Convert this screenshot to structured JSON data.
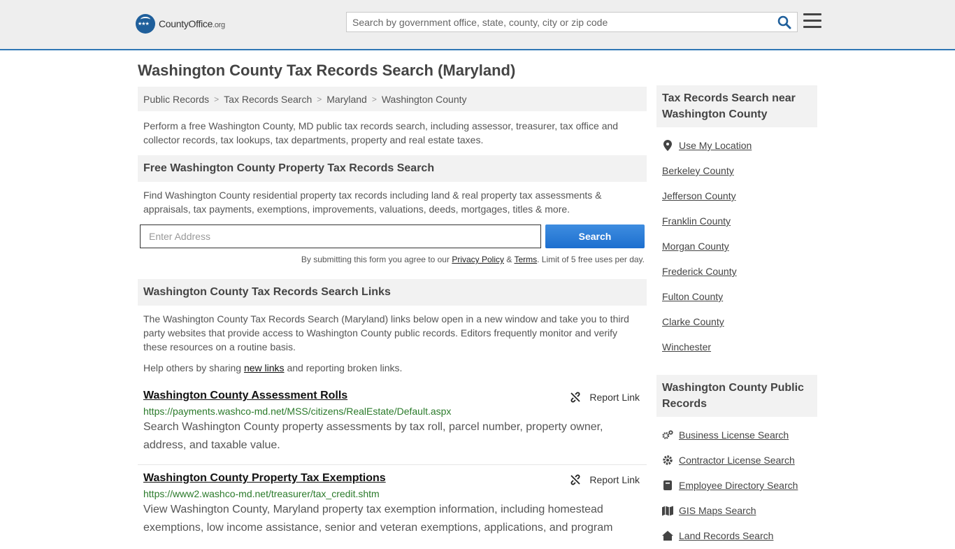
{
  "header": {
    "logo_main": "CountyOffice",
    "logo_suffix": ".org",
    "search_placeholder": "Search by government office, state, county, city or zip code"
  },
  "page_title": "Washington County Tax Records Search (Maryland)",
  "breadcrumbs": [
    "Public Records",
    "Tax Records Search",
    "Maryland",
    "Washington County"
  ],
  "intro": "Perform a free Washington County, MD public tax records search, including assessor, treasurer, tax office and collector records, tax lookups, tax departments, property and real estate taxes.",
  "property_search": {
    "heading": "Free Washington County Property Tax Records Search",
    "description": "Find Washington County residential property tax records including land & real property tax assessments & appraisals, tax payments, exemptions, improvements, valuations, deeds, mortgages, titles & more.",
    "address_placeholder": "Enter Address",
    "button_label": "Search",
    "disclaimer_prefix": "By submitting this form you agree to our ",
    "privacy_label": "Privacy Policy",
    "amp": " & ",
    "terms_label": "Terms",
    "disclaimer_suffix": ". Limit of 5 free uses per day."
  },
  "links_section": {
    "heading": "Washington County Tax Records Search Links",
    "description": "The Washington County Tax Records Search (Maryland) links below open in a new window and take you to third party websites that provide access to Washington County public records. Editors frequently monitor and verify these resources on a routine basis.",
    "help_prefix": "Help others by sharing ",
    "help_link": "new links",
    "help_suffix": " and reporting broken links.",
    "report_label": "Report Link",
    "results": [
      {
        "title": "Washington County Assessment Rolls",
        "url": "https://payments.washco-md.net/MSS/citizens/RealEstate/Default.aspx",
        "description": "Search Washington County property assessments by tax roll, parcel number, property owner, address, and taxable value."
      },
      {
        "title": "Washington County Property Tax Exemptions",
        "url": "https://www2.washco-md.net/treasurer/tax_credit.shtm",
        "description": "View Washington County, Maryland property tax exemption information, including homestead exemptions, low income assistance, senior and veteran exemptions, applications, and program"
      }
    ]
  },
  "sidebar": {
    "nearby_heading": "Tax Records Search near Washington County",
    "use_location": "Use My Location",
    "nearby": [
      "Berkeley County",
      "Jefferson County",
      "Franklin County",
      "Morgan County",
      "Frederick County",
      "Fulton County",
      "Clarke County",
      "Winchester"
    ],
    "public_heading": "Washington County Public Records",
    "public_links": [
      {
        "label": "Business License Search",
        "icon": "gears-icon"
      },
      {
        "label": "Contractor License Search",
        "icon": "gear-icon"
      },
      {
        "label": "Employee Directory Search",
        "icon": "book-icon"
      },
      {
        "label": "GIS Maps Search",
        "icon": "map-icon"
      },
      {
        "label": "Land Records Search",
        "icon": "home-icon"
      }
    ]
  },
  "colors": {
    "accent": "#2f77b5",
    "button": "#1d6fcf",
    "url_green": "#2a7a2a"
  }
}
